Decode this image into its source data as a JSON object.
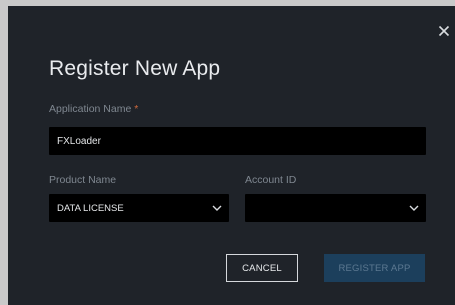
{
  "dialog": {
    "title": "Register New App",
    "close_icon": "close-icon",
    "app_name": {
      "label": "Application Name",
      "required_mark": "*",
      "value": "FXLoader"
    },
    "product_name": {
      "label": "Product Name",
      "selected": "DATA LICENSE",
      "icon": "chevron-down-icon"
    },
    "account_id": {
      "label": "Account ID",
      "selected": "",
      "icon": "chevron-down-icon"
    },
    "buttons": {
      "cancel_label": "CANCEL",
      "register_label": "REGISTER APP"
    }
  },
  "colors": {
    "dialog_bg": "#1f2329",
    "field_bg": "#000000",
    "label": "#7f8790",
    "required": "#d06a3d",
    "primary_disabled_bg": "#1c3f5c",
    "primary_disabled_text": "#5c7891"
  }
}
